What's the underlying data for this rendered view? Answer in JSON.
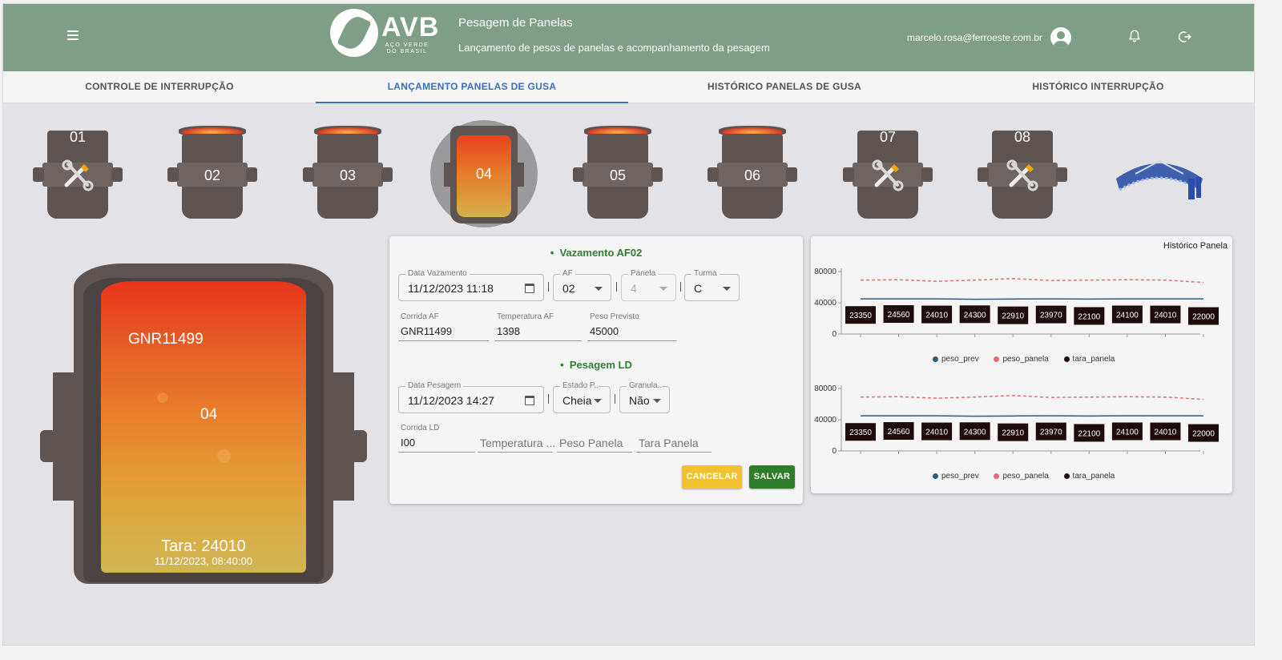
{
  "header": {
    "logo_text": "AVB",
    "logo_sub": "AÇO VERDE DO BRASIL",
    "title": "Pesagem de Panelas",
    "subtitle": "Lançamento de pesos de panelas e acompanhamento da pesagem",
    "user_email": "marcelo.rosa@ferroeste.com.br"
  },
  "tabs": [
    {
      "label": "CONTROLE DE INTERRUPÇÃO",
      "active": false
    },
    {
      "label": "LANÇAMENTO PANELAS DE GUSA",
      "active": true
    },
    {
      "label": "HISTÓRICO PANELAS DE GUSA",
      "active": false
    },
    {
      "label": "HISTÓRICO INTERRUPÇÃO",
      "active": false
    }
  ],
  "ladles": [
    {
      "number": "01",
      "state": "maintenance"
    },
    {
      "number": "02",
      "state": "available"
    },
    {
      "number": "03",
      "state": "available"
    },
    {
      "number": "04",
      "state": "selected"
    },
    {
      "number": "05",
      "state": "available"
    },
    {
      "number": "06",
      "state": "available"
    },
    {
      "number": "07",
      "state": "maintenance"
    },
    {
      "number": "08",
      "state": "maintenance"
    }
  ],
  "selected_ladle": {
    "corrida": "GNR11499",
    "number": "04",
    "tara": "Tara: 24010",
    "datetime": "11/12/2023, 08:40:00"
  },
  "form": {
    "vazamento_title": "Vazamento AF02",
    "data_vazamento": {
      "label": "Data Vazamento",
      "value": "11/12/2023 11:18"
    },
    "af": {
      "label": "AF",
      "value": "02"
    },
    "panela": {
      "label": "Panela",
      "value": "4"
    },
    "turma": {
      "label": "Turma",
      "value": "C"
    },
    "corrida_af": {
      "label": "Corrida AF",
      "value": "GNR11499"
    },
    "temperatura_af": {
      "label": "Temperatura AF",
      "value": "1398"
    },
    "peso_previsto": {
      "label": "Peso Previsto",
      "value": "45000"
    },
    "pesagem_title": "Pesagem LD",
    "data_pesagem": {
      "label": "Data Pesagem",
      "value": "11/12/2023 14:27"
    },
    "estado": {
      "label": "Estado P...",
      "value": "Cheia"
    },
    "granula": {
      "label": "Granula...",
      "value": "Não"
    },
    "corrida_ld": {
      "label": "Corrida LD",
      "value": "I00"
    },
    "temperatura_ph": "Temperatura ...",
    "peso_panela_ph": "Peso Panela",
    "tara_panela_ph": "Tara Panela",
    "cancel_label": "CANCELAR",
    "save_label": "SALVAR"
  },
  "colors": {
    "header": "#7e9e87",
    "tab_active": "#3b6fb6",
    "green_title": "#2e7d32",
    "cancel": "#f2c12e",
    "save": "#2e7d2a",
    "peso_prev": "#2f5b7c",
    "peso_panela": "#e07070",
    "tara_panela": "#1e0c0c"
  },
  "chart_data": [
    {
      "type": "line",
      "title": "Histórico Panela",
      "ylim": [
        0,
        80000
      ],
      "yticks": [
        "80000",
        "40000",
        "0"
      ],
      "bar_labels": [
        "23350",
        "24560",
        "24010",
        "24300",
        "22910",
        "23970",
        "22100",
        "24100",
        "24010",
        "22000"
      ],
      "series": [
        {
          "name": "peso_prev",
          "values": [
            45000,
            45000,
            45000,
            44500,
            44800,
            45000,
            44800,
            45000,
            45000,
            45000
          ]
        },
        {
          "name": "peso_panela",
          "values": [
            69000,
            69500,
            67500,
            69000,
            71000,
            68500,
            69000,
            69500,
            69000,
            66000
          ]
        },
        {
          "name": "tara_panela",
          "values": [
            23350,
            24560,
            24010,
            24300,
            22910,
            23970,
            22100,
            24100,
            24010,
            22000
          ]
        }
      ],
      "legend": [
        "peso_prev",
        "peso_panela",
        "tara_panela"
      ]
    },
    {
      "type": "line",
      "ylim": [
        0,
        80000
      ],
      "yticks": [
        "80000",
        "40000",
        "0"
      ],
      "bar_labels": [
        "23350",
        "24560",
        "24010",
        "24300",
        "22910",
        "23970",
        "22100",
        "24100",
        "24010",
        "22000"
      ],
      "series": [
        {
          "name": "peso_prev",
          "values": [
            45000,
            45000,
            45000,
            44500,
            44800,
            45000,
            44800,
            45000,
            45000,
            45000
          ]
        },
        {
          "name": "peso_panela",
          "values": [
            69000,
            69500,
            67500,
            69000,
            71000,
            68500,
            69000,
            69500,
            69000,
            66000
          ]
        },
        {
          "name": "tara_panela",
          "values": [
            23350,
            24560,
            24010,
            24300,
            22910,
            23970,
            22100,
            24100,
            24010,
            22000
          ]
        }
      ],
      "legend": [
        "peso_prev",
        "peso_panela",
        "tara_panela"
      ]
    }
  ]
}
